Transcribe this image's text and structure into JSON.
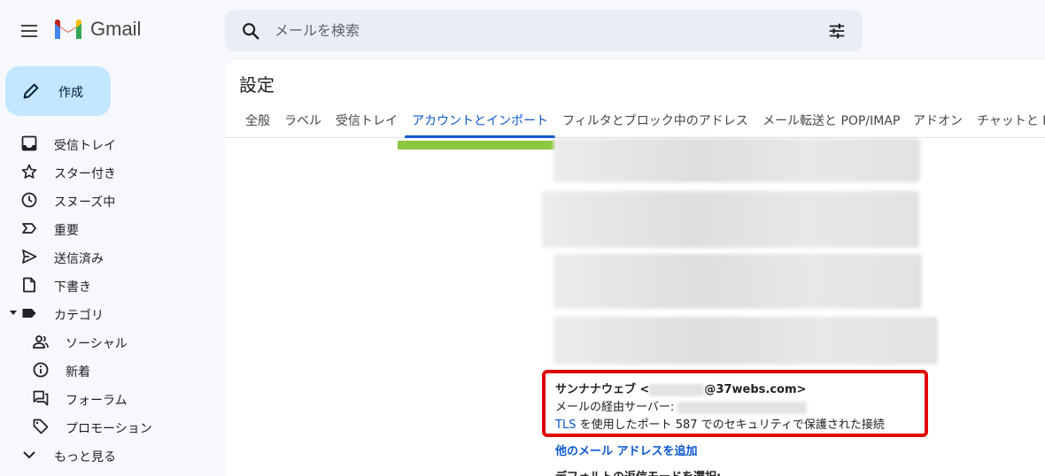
{
  "header": {
    "app_name": "Gmail",
    "search_placeholder": "メールを検索"
  },
  "sidebar": {
    "compose_label": "作成",
    "items": [
      {
        "label": "受信トレイ",
        "icon": "inbox-icon"
      },
      {
        "label": "スター付き",
        "icon": "star-icon"
      },
      {
        "label": "スヌーズ中",
        "icon": "clock-icon"
      },
      {
        "label": "重要",
        "icon": "important-icon"
      },
      {
        "label": "送信済み",
        "icon": "send-icon"
      },
      {
        "label": "下書き",
        "icon": "draft-icon"
      },
      {
        "label": "カテゴリ",
        "icon": "label-icon"
      },
      {
        "label": "ソーシャル",
        "icon": "people-icon"
      },
      {
        "label": "新着",
        "icon": "info-icon"
      },
      {
        "label": "フォーラム",
        "icon": "forum-icon"
      },
      {
        "label": "プロモーション",
        "icon": "tag-icon"
      },
      {
        "label": "もっと見る",
        "icon": "chevron-down-icon"
      }
    ]
  },
  "settings": {
    "title": "設定",
    "tabs": [
      "全般",
      "ラベル",
      "受信トレイ",
      "アカウントとインポート",
      "フィルタとブロック中のアドレス",
      "メール転送と POP/IMAP",
      "アドオン",
      "チャットと M"
    ],
    "active_tab": "アカウントとインポート"
  },
  "account": {
    "name_prefix": "サンナナウェブ <",
    "email_domain": "@37webs.com>",
    "server_label": "メールの経由サーバー:",
    "tls_word": "TLS",
    "tls_rest": " を使用したポート 587 でのセキュリティで保護された接続",
    "add_link": "他のメール アドレスを追加",
    "default_label": "デフォルトの返信モードを選択:"
  },
  "colors": {
    "accent": "#0b57d0",
    "compose_bg": "#c2e7ff",
    "highlight_red": "#e00000",
    "highlight_green": "#8dc63f"
  }
}
